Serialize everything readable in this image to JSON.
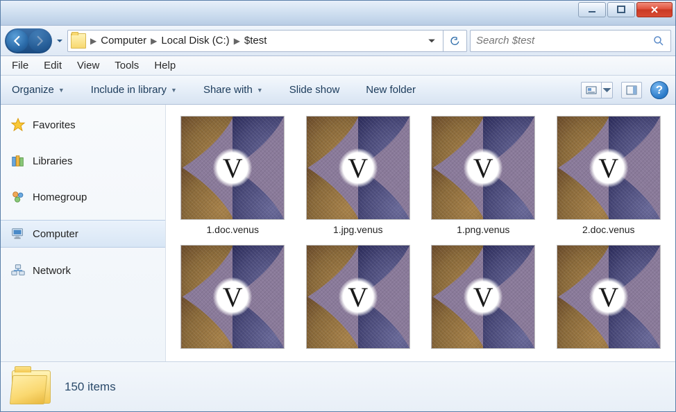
{
  "breadcrumb": {
    "segments": [
      "Computer",
      "Local Disk (C:)",
      "$test"
    ]
  },
  "search": {
    "placeholder": "Search $test"
  },
  "menubar": [
    "File",
    "Edit",
    "View",
    "Tools",
    "Help"
  ],
  "toolbar": {
    "organize": "Organize",
    "include": "Include in library",
    "share": "Share with",
    "slideshow": "Slide show",
    "newfolder": "New folder"
  },
  "sidebar": {
    "items": [
      {
        "label": "Favorites",
        "icon": "star"
      },
      {
        "label": "Libraries",
        "icon": "libraries"
      },
      {
        "label": "Homegroup",
        "icon": "homegroup"
      },
      {
        "label": "Computer",
        "icon": "computer",
        "selected": true
      },
      {
        "label": "Network",
        "icon": "network"
      }
    ]
  },
  "files": [
    {
      "name": "1.doc.venus"
    },
    {
      "name": "1.jpg.venus"
    },
    {
      "name": "1.png.venus"
    },
    {
      "name": "2.doc.venus"
    },
    {
      "name": ""
    },
    {
      "name": ""
    },
    {
      "name": ""
    },
    {
      "name": ""
    }
  ],
  "status": {
    "count": "150 items"
  },
  "thumb_letter": "V",
  "help_symbol": "?"
}
